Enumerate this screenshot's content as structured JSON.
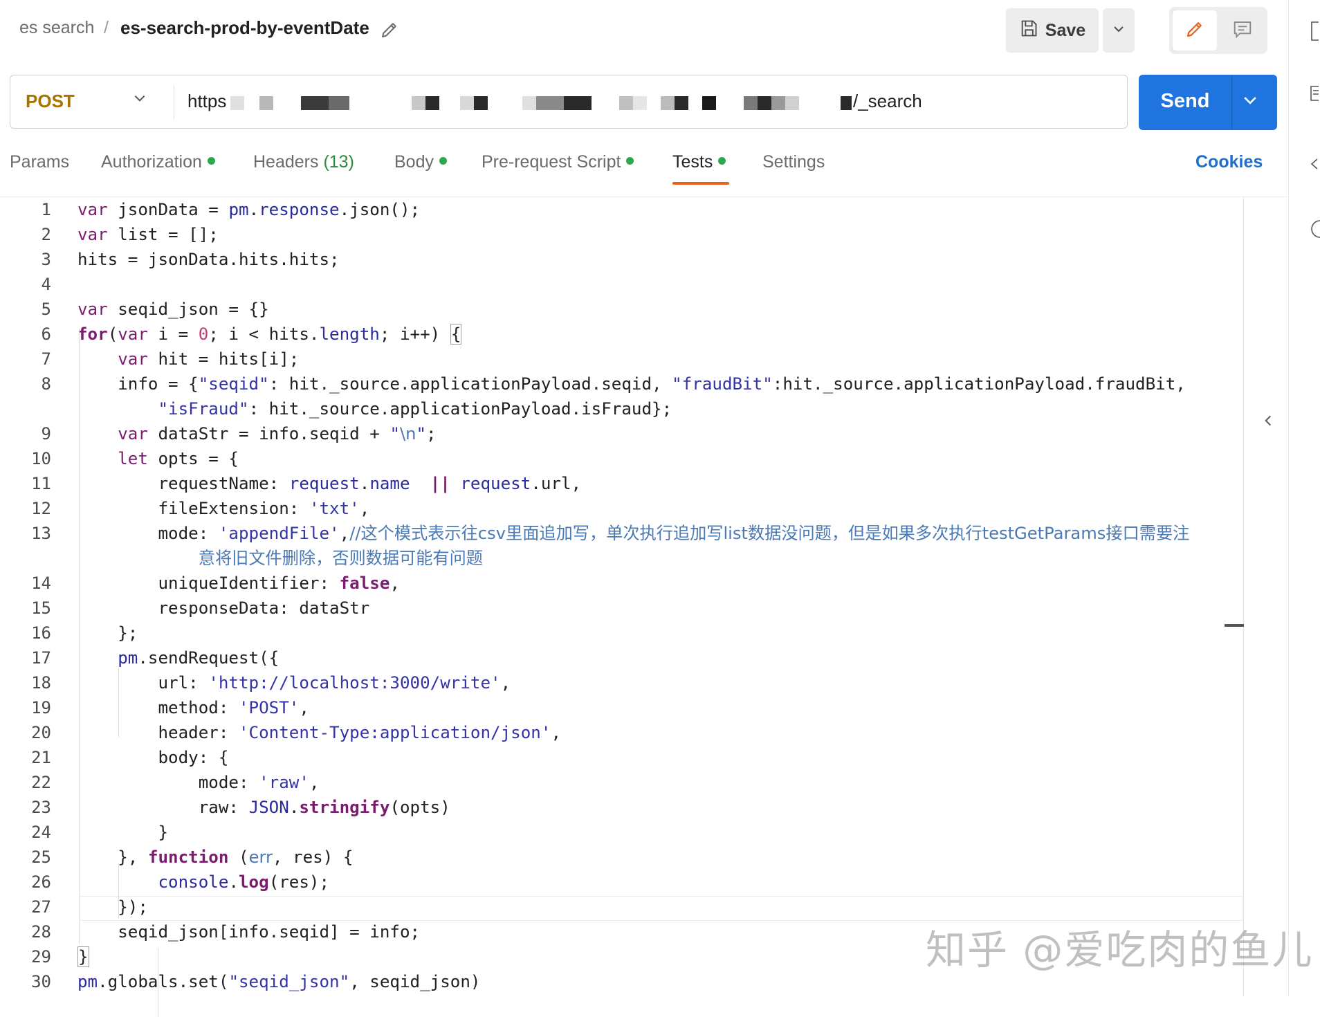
{
  "breadcrumb": {
    "parent": "es search",
    "separator": "/",
    "title": "es-search-prod-by-eventDate"
  },
  "toolbar": {
    "save_label": "Save"
  },
  "request": {
    "method": "POST",
    "url_prefix": "https",
    "url_suffix": "/_search",
    "send_label": "Send"
  },
  "tabs": [
    {
      "label": "Params",
      "dot": false
    },
    {
      "label": "Authorization",
      "dot": true
    },
    {
      "label": "Headers",
      "count": "(13)",
      "dot": false
    },
    {
      "label": "Body",
      "dot": true
    },
    {
      "label": "Pre-request Script",
      "dot": true
    },
    {
      "label": "Tests",
      "dot": true,
      "active": true
    },
    {
      "label": "Settings",
      "dot": false
    }
  ],
  "cookies_label": "Cookies",
  "colors": {
    "send": "#1f74e0",
    "method": "#a87400",
    "active_tab": "#e8611a",
    "dot": "#2aa84a"
  },
  "icons": [
    "edit-pencil-icon",
    "save-disk-icon",
    "chevron-down-icon",
    "edit-mode-icon",
    "comment-icon",
    "collapse-left-icon"
  ],
  "code": {
    "line_numbers": [
      "1",
      "2",
      "3",
      "4",
      "5",
      "6",
      "7",
      "8",
      "",
      "9",
      "10",
      "11",
      "12",
      "13",
      "",
      "14",
      "15",
      "16",
      "17",
      "18",
      "19",
      "20",
      "21",
      "22",
      "23",
      "24",
      "25",
      "26",
      "27",
      "28",
      "29",
      "30"
    ],
    "lines": [
      [
        [
          "kw",
          "var"
        ],
        [
          "t",
          " jsonData = "
        ],
        [
          "prop",
          "pm"
        ],
        [
          "t",
          "."
        ],
        [
          "prop",
          "response"
        ],
        [
          "t",
          ".json();"
        ]
      ],
      [
        [
          "kw",
          "var"
        ],
        [
          "t",
          " list = [];"
        ]
      ],
      [
        [
          "t",
          "hits = jsonData.hits.hits;"
        ]
      ],
      [],
      [
        [
          "kw",
          "var"
        ],
        [
          "t",
          " seqid_json = {}"
        ]
      ],
      [
        [
          "kwb",
          "for"
        ],
        [
          "t",
          "("
        ],
        [
          "kw",
          "var"
        ],
        [
          "t",
          " i = "
        ],
        [
          "num",
          "0"
        ],
        [
          "t",
          "; i < hits."
        ],
        [
          "prop",
          "length"
        ],
        [
          "t",
          "; i++) "
        ],
        [
          "box",
          "{"
        ]
      ],
      [
        [
          "t",
          "    "
        ],
        [
          "kw",
          "var"
        ],
        [
          "t",
          " hit = hits[i];"
        ]
      ],
      [
        [
          "t",
          "    info = {"
        ],
        [
          "str",
          "\"seqid\""
        ],
        [
          "t",
          ": hit._source.applicationPayload.seqid, "
        ],
        [
          "str",
          "\"fraudBit\""
        ],
        [
          "t",
          ":hit._source.applicationPayload.fraudBit,"
        ]
      ],
      [
        [
          "t",
          "        "
        ],
        [
          "str",
          "\"isFraud\""
        ],
        [
          "t",
          ": hit._source.applicationPayload.isFraud};"
        ]
      ],
      [
        [
          "t",
          "    "
        ],
        [
          "kw",
          "var"
        ],
        [
          "t",
          " dataStr = info.seqid + "
        ],
        [
          "str",
          "\""
        ],
        [
          "cmt",
          "\\n"
        ],
        [
          "str",
          "\""
        ],
        [
          "t",
          ";"
        ]
      ],
      [
        [
          "t",
          "    "
        ],
        [
          "kw",
          "let"
        ],
        [
          "t",
          " opts = {"
        ]
      ],
      [
        [
          "t",
          "        requestName: "
        ],
        [
          "prop",
          "request"
        ],
        [
          "t",
          "."
        ],
        [
          "prop",
          "name"
        ],
        [
          "t",
          "  "
        ],
        [
          "kwb",
          "||"
        ],
        [
          "t",
          " "
        ],
        [
          "prop",
          "request"
        ],
        [
          "t",
          ".url,"
        ]
      ],
      [
        [
          "t",
          "        fileExtension: "
        ],
        [
          "str",
          "'txt'"
        ],
        [
          "t",
          ","
        ]
      ],
      [
        [
          "t",
          "        mode: "
        ],
        [
          "str",
          "'appendFile'"
        ],
        [
          "t",
          ","
        ],
        [
          "cmt",
          "//这个模式表示往csv里面追加写，单次执行追加写list数据没问题，但是如果多次执行testGetParams接口需要注"
        ]
      ],
      [
        [
          "t",
          "            "
        ],
        [
          "cmt",
          "意将旧文件删除，否则数据可能有问题"
        ]
      ],
      [
        [
          "t",
          "        uniqueIdentifier: "
        ],
        [
          "kwb",
          "false"
        ],
        [
          "t",
          ","
        ]
      ],
      [
        [
          "t",
          "        responseData: dataStr"
        ]
      ],
      [
        [
          "t",
          "    };"
        ]
      ],
      [
        [
          "t",
          "    "
        ],
        [
          "prop",
          "pm"
        ],
        [
          "t",
          ".sendRequest({"
        ]
      ],
      [
        [
          "t",
          "        url: "
        ],
        [
          "str",
          "'http://localhost:3000/write'"
        ],
        [
          "t",
          ","
        ]
      ],
      [
        [
          "t",
          "        method: "
        ],
        [
          "str",
          "'POST'"
        ],
        [
          "t",
          ","
        ]
      ],
      [
        [
          "t",
          "        header: "
        ],
        [
          "str",
          "'Content-Type:application/json'"
        ],
        [
          "t",
          ","
        ]
      ],
      [
        [
          "t",
          "        body: {"
        ]
      ],
      [
        [
          "t",
          "            mode: "
        ],
        [
          "str",
          "'raw'"
        ],
        [
          "t",
          ","
        ]
      ],
      [
        [
          "t",
          "            raw: "
        ],
        [
          "prop",
          "JSON"
        ],
        [
          "t",
          "."
        ],
        [
          "kwb",
          "stringify"
        ],
        [
          "t",
          "(opts)"
        ]
      ],
      [
        [
          "t",
          "        }"
        ]
      ],
      [
        [
          "t",
          "    }, "
        ],
        [
          "kwb",
          "function"
        ],
        [
          "t",
          " ("
        ],
        [
          "cmt",
          "err"
        ],
        [
          "t",
          ", res) {"
        ]
      ],
      [
        [
          "t",
          "        "
        ],
        [
          "prop",
          "console"
        ],
        [
          "t",
          "."
        ],
        [
          "kwb",
          "log"
        ],
        [
          "t",
          "(res);"
        ]
      ],
      [
        [
          "t",
          "    });"
        ]
      ],
      [
        [
          "t",
          "    seqid_json[info.seqid] = info;"
        ]
      ],
      [
        [
          "box",
          "}"
        ]
      ],
      [
        [
          "prop",
          "pm"
        ],
        [
          "t",
          ".globals.set("
        ],
        [
          "str",
          "\"seqid_json\""
        ],
        [
          "t",
          ", seqid_json)"
        ]
      ]
    ]
  },
  "watermark": "知乎 @爱吃肉的鱼儿"
}
